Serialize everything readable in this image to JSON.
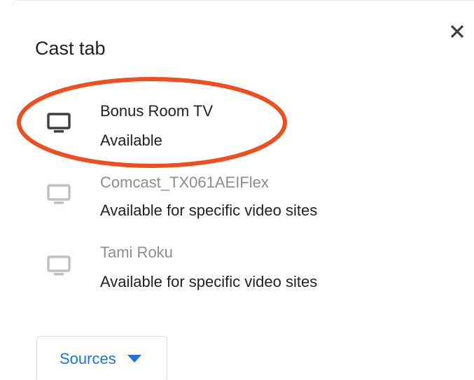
{
  "dialog": {
    "title": "Cast tab",
    "close_icon": "close-icon"
  },
  "sinks": [
    {
      "name": "Bonus Room TV",
      "status": "Available",
      "icon": "tv-icon",
      "state": "available"
    },
    {
      "name": "Comcast_TX061AEIFlex",
      "status": "Available for specific video sites",
      "icon": "tv-icon",
      "state": "disabled"
    },
    {
      "name": "Tami Roku",
      "status": "Available for specific video sites",
      "icon": "tv-icon",
      "state": "disabled"
    }
  ],
  "sources": {
    "label": "Sources",
    "icon": "dropdown-arrow-icon"
  },
  "colors": {
    "text": "#202124",
    "disabled_text": "#8a8d91",
    "accent": "#1a73e8",
    "highlight": "#f04e1f",
    "icon_active": "#3c4043",
    "icon_disabled": "#bdc1c6"
  }
}
